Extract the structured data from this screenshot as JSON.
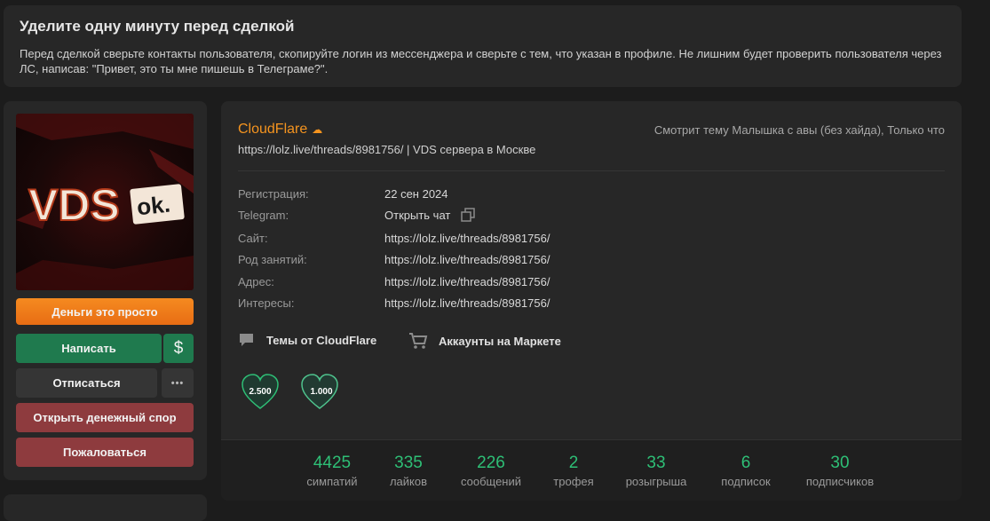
{
  "notice": {
    "title": "Уделите одну минуту перед сделкой",
    "text": "Перед сделкой сверьте контакты пользователя, скопируйте логин из мессенджера и сверьте с тем, что указан в профиле. Не лишним будет проверить пользователя через ЛС, написав: \"Привет, это ты мне пишешь в Телеграме?\"."
  },
  "sidebar": {
    "avatar_text": "VDS",
    "avatar_badge": "ok.",
    "banner_label": "Деньги это просто",
    "write_label": "Написать",
    "dollar_label": "$",
    "unfollow_label": "Отписаться",
    "more_label": "•••",
    "dispute_label": "Открыть денежный спор",
    "report_label": "Пожаловаться"
  },
  "profile": {
    "username": "CloudFlare",
    "username_icon": "☁",
    "status": "https://lolz.live/threads/8981756/ | VDS сервера в Москве",
    "activity": "Смотрит тему Малышка с авы (без хайда), Только что",
    "info": [
      {
        "label": "Регистрация:",
        "value": "22 сен 2024"
      },
      {
        "label": "Telegram:",
        "value": "Открыть чат"
      },
      {
        "label": "Сайт:",
        "value": "https://lolz.live/threads/8981756/"
      },
      {
        "label": "Род занятий:",
        "value": "https://lolz.live/threads/8981756/"
      },
      {
        "label": "Адрес:",
        "value": "https://lolz.live/threads/8981756/"
      },
      {
        "label": "Интересы:",
        "value": "https://lolz.live/threads/8981756/"
      }
    ],
    "links": {
      "threads": "Темы от CloudFlare",
      "market": "Аккаунты на Маркете"
    },
    "awards": [
      {
        "value": "2.500",
        "icon": "heart-badge-icon"
      },
      {
        "value": "1.000",
        "icon": "heart-badge-icon"
      }
    ]
  },
  "stats": [
    {
      "value": "4425",
      "label": "симпатий"
    },
    {
      "value": "335",
      "label": "лайков"
    },
    {
      "value": "226",
      "label": "сообщений"
    },
    {
      "value": "2",
      "label": "трофея"
    },
    {
      "value": "33",
      "label": "розыгрыша"
    },
    {
      "value": "6",
      "label": "подписок"
    },
    {
      "value": "30",
      "label": "подписчиков"
    }
  ],
  "colors": {
    "accent_green": "#2ebf76",
    "username_orange": "#f5941f",
    "danger_red": "#8e3b3e"
  }
}
